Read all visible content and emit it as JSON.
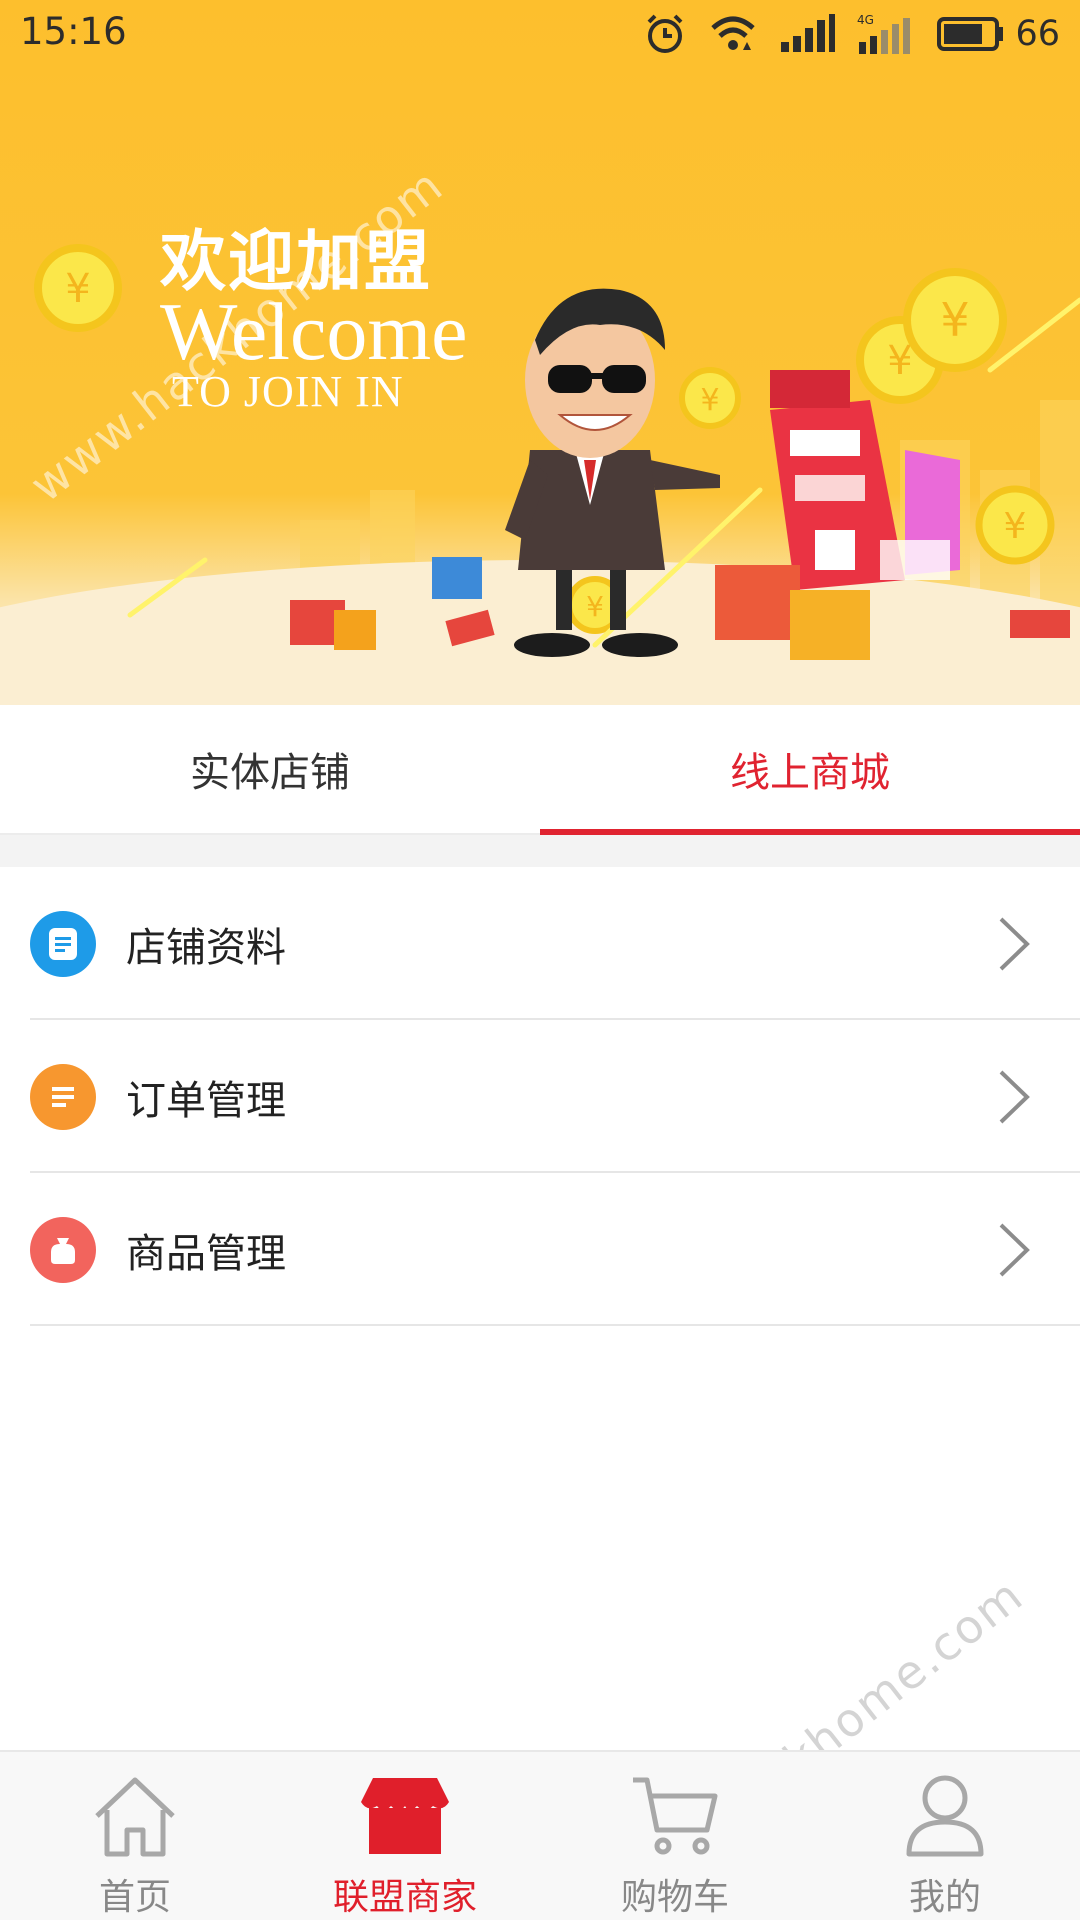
{
  "status_bar": {
    "time": "15:16",
    "battery": "66",
    "network": "4G"
  },
  "banner": {
    "title_cn": "欢迎加盟",
    "title_en": "Welcome",
    "subtitle": "TO JOIN IN",
    "watermark": "www.hackhome.com"
  },
  "tabs": [
    {
      "label": "实体店铺",
      "active": false
    },
    {
      "label": "线上商城",
      "active": true
    }
  ],
  "menu": [
    {
      "label": "店铺资料",
      "icon": "document-icon",
      "color": "#1e9be8"
    },
    {
      "label": "订单管理",
      "icon": "list-icon",
      "color": "#f7972f"
    },
    {
      "label": "商品管理",
      "icon": "bag-icon",
      "color": "#f2645d"
    }
  ],
  "bottom_nav": [
    {
      "label": "首页",
      "icon": "home-icon",
      "active": false
    },
    {
      "label": "联盟商家",
      "icon": "store-icon",
      "active": true
    },
    {
      "label": "购物车",
      "icon": "cart-icon",
      "active": false
    },
    {
      "label": "我的",
      "icon": "user-icon",
      "active": false
    }
  ],
  "colors": {
    "accent": "#e02330",
    "banner_bg": "#fdbf2d"
  }
}
